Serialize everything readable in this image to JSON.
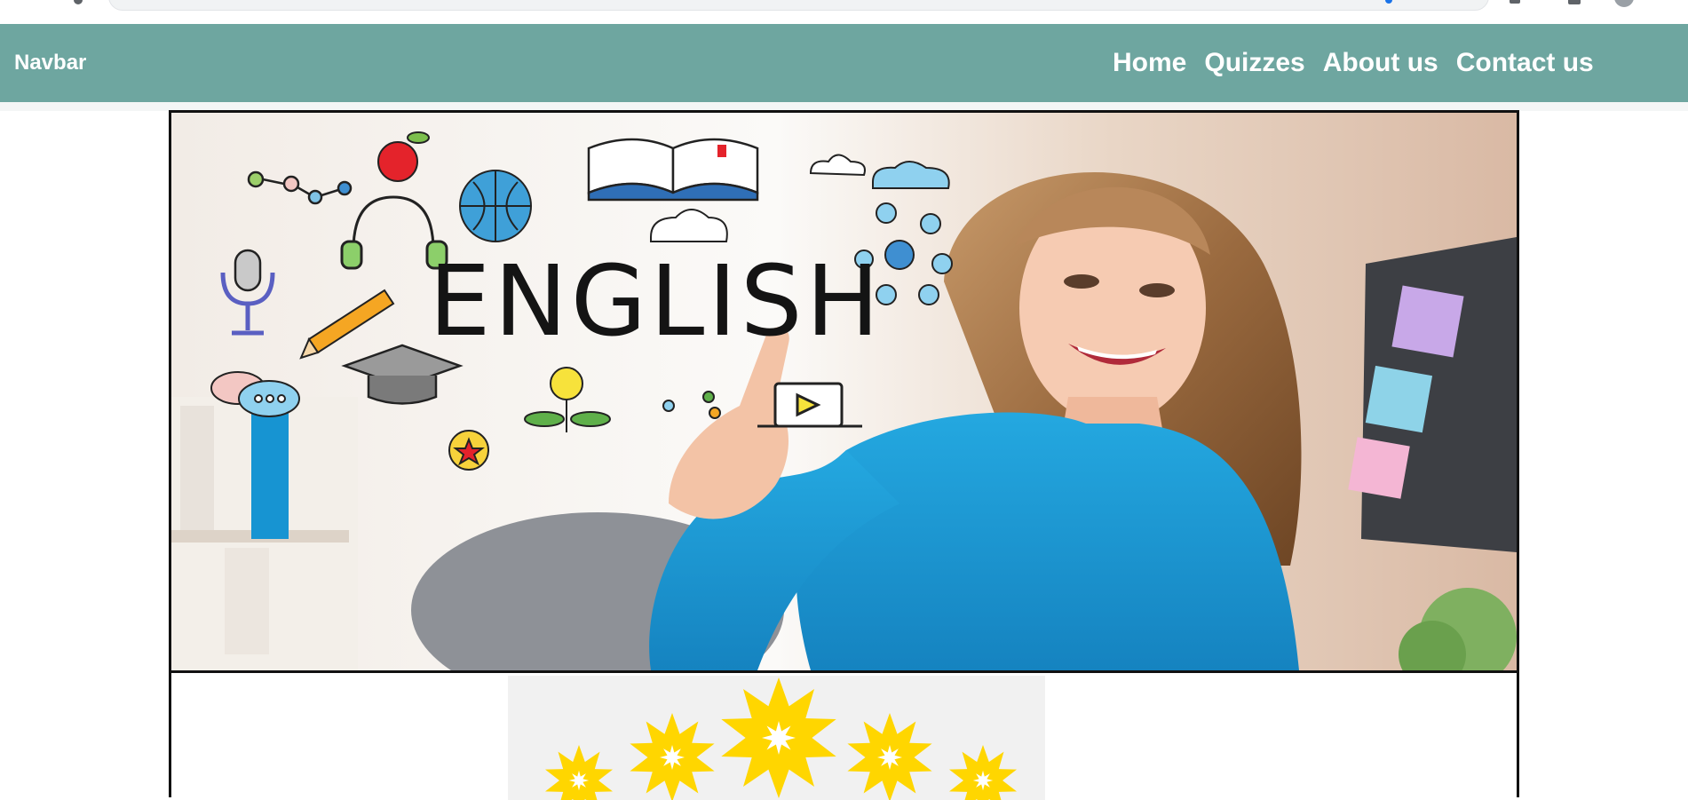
{
  "navbar": {
    "brand": "Navbar",
    "links": [
      "Home",
      "Quizzes",
      "About us",
      "Contact us"
    ]
  },
  "hero": {
    "word": "ENGLISH"
  },
  "colors": {
    "navbar_bg": "#6ea6a0",
    "star_yellow": "#ffd600",
    "shirt_blue": "#1e9fd6"
  },
  "icons": [
    "chrome-avatar-icon",
    "apple-icon",
    "book-icon",
    "globe-icon",
    "headphones-icon",
    "microphone-icon",
    "pencil-icon",
    "cloud-icon",
    "network-icon",
    "graduation-cap-icon",
    "lightbulb-icon",
    "laptop-play-icon",
    "chat-bubble-icon",
    "award-badge-icon",
    "star-icon"
  ]
}
